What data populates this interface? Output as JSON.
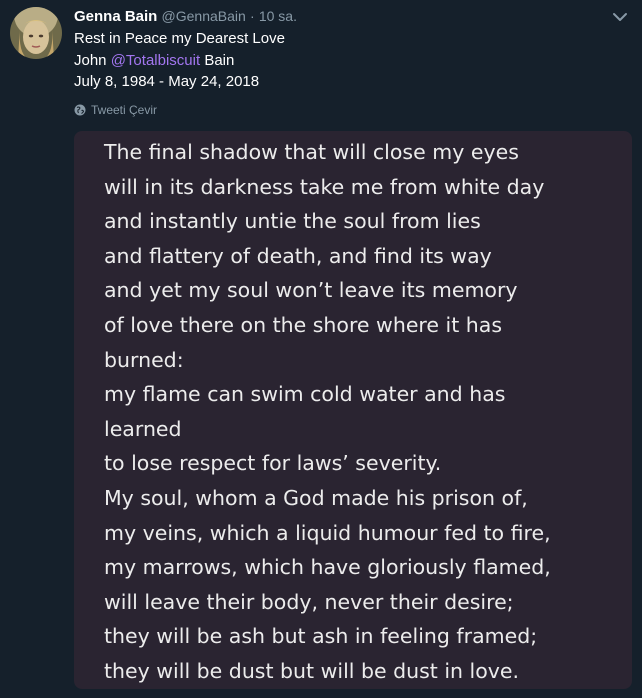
{
  "tweet": {
    "display_name": "Genna Bain",
    "handle": "@GennaBain",
    "separator": "·",
    "time": "10 sa.",
    "text_line1": "Rest in Peace my Dearest Love",
    "text_line2_prefix": "John",
    "mention": "@Totalbiscuit",
    "text_line2_suffix": "Bain",
    "text_line3": "July 8, 1984 - May 24, 2018",
    "translate_label": "Tweeti Çevir"
  },
  "media": {
    "poem_lines": [
      "The final shadow that will close my eyes",
      "will in its darkness take me from white day",
      "and instantly untie the soul from lies",
      "and flattery of death, and find its way",
      "and yet my soul won’t leave its memory",
      "of love there on the shore where it has",
      "burned:",
      "my flame can swim cold water and has",
      "learned",
      "to lose respect for laws’ severity.",
      "My soul, whom a God made his prison of,",
      "my veins, which a liquid humour fed to fire,",
      "my marrows, which have gloriously flamed,",
      "will leave their body, never their desire;",
      "they will be ash but ash in feeling framed;",
      "they will be dust but will be dust in love."
    ]
  },
  "colors": {
    "background": "#15202b",
    "mention": "#a276ef",
    "muted": "#8899a6",
    "media_background": "#2a2431"
  },
  "icons": [
    "avatar",
    "chevron-down-icon",
    "globe-icon"
  ]
}
